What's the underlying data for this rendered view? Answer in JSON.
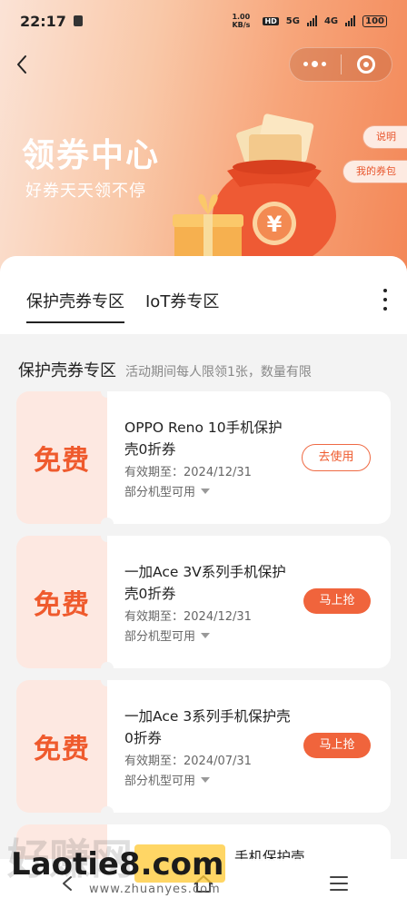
{
  "status": {
    "time": "22:17",
    "speed": "1.00 KB/s",
    "hd": "HD",
    "net1": "5G",
    "net2": "4G",
    "battery": "100"
  },
  "header": {
    "title": "领券中心",
    "subtitle": "好券天天领不停",
    "explain_btn": "说明",
    "wallet_btn": "我的券包"
  },
  "tabs": [
    {
      "label": "保护壳券专区",
      "active": true
    },
    {
      "label": "IoT券专区",
      "active": false
    }
  ],
  "section": {
    "title": "保护壳券专区",
    "note": "活动期间每人限领1张，数量有限"
  },
  "coupons": [
    {
      "badge": "免费",
      "name": "OPPO Reno 10手机保护壳0折券",
      "expiry": "有效期至：2024/12/31",
      "models": "部分机型可用",
      "action": "去使用",
      "action_style": "outline"
    },
    {
      "badge": "免费",
      "name": "一加Ace 3V系列手机保护壳0折券",
      "expiry": "有效期至：2024/12/31",
      "models": "部分机型可用",
      "action": "马上抢",
      "action_style": "filled"
    },
    {
      "badge": "免费",
      "name": "一加Ace 3系列手机保护壳0折券",
      "expiry": "有效期至：2024/07/31",
      "models": "部分机型可用",
      "action": "马上抢",
      "action_style": "filled"
    }
  ],
  "partial_coupon": {
    "name": "手机保护壳"
  },
  "watermark": {
    "brand": "Laotie8.com",
    "domain": "www.zhuanyes.com",
    "bg": "好赚网"
  },
  "colors": {
    "accent": "#f0643c",
    "coupon_tint": "#fde8e1",
    "hero_start": "#fbe3d6",
    "hero_end": "#f38656"
  },
  "icons": [
    "back-icon",
    "more-icon",
    "close-mini-program-icon",
    "kebab-menu-icon",
    "caret-down-icon",
    "home-icon",
    "menu-icon",
    "back-nav-icon"
  ]
}
